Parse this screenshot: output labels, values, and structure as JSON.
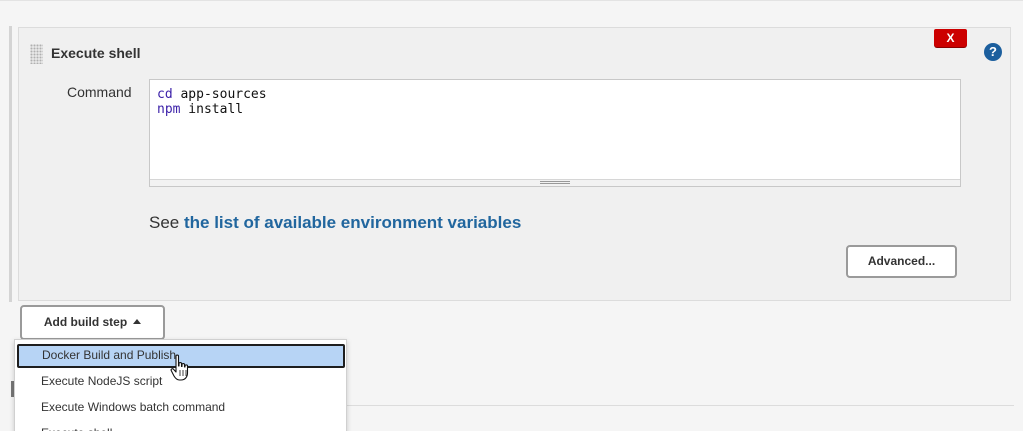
{
  "step": {
    "title": "Execute shell",
    "delete_label": "X",
    "help_label": "?",
    "command_label": "Command",
    "command_lines": [
      {
        "keyword": "cd",
        "rest": " app-sources"
      },
      {
        "keyword": "npm",
        "rest": " install"
      }
    ],
    "env_prefix": "See ",
    "env_link": "the list of available environment variables",
    "advanced_label": "Advanced..."
  },
  "add_step": {
    "label": "Add build step"
  },
  "menu": {
    "items": [
      {
        "label": "Docker Build and Publish",
        "selected": true
      },
      {
        "label": "Execute NodeJS script",
        "selected": false
      },
      {
        "label": "Execute Windows batch command",
        "selected": false
      },
      {
        "label": "Execute shell",
        "selected": false
      }
    ]
  },
  "colors": {
    "link": "#21669e",
    "delete": "#cc0000",
    "help": "#1c5f9e",
    "menu_highlight": "#b7d4f5"
  },
  "icons": {
    "help": "question-circle-icon",
    "caret": "caret-up-icon",
    "cursor": "hand-pointer-icon",
    "drag": "drag-handle-icon"
  }
}
